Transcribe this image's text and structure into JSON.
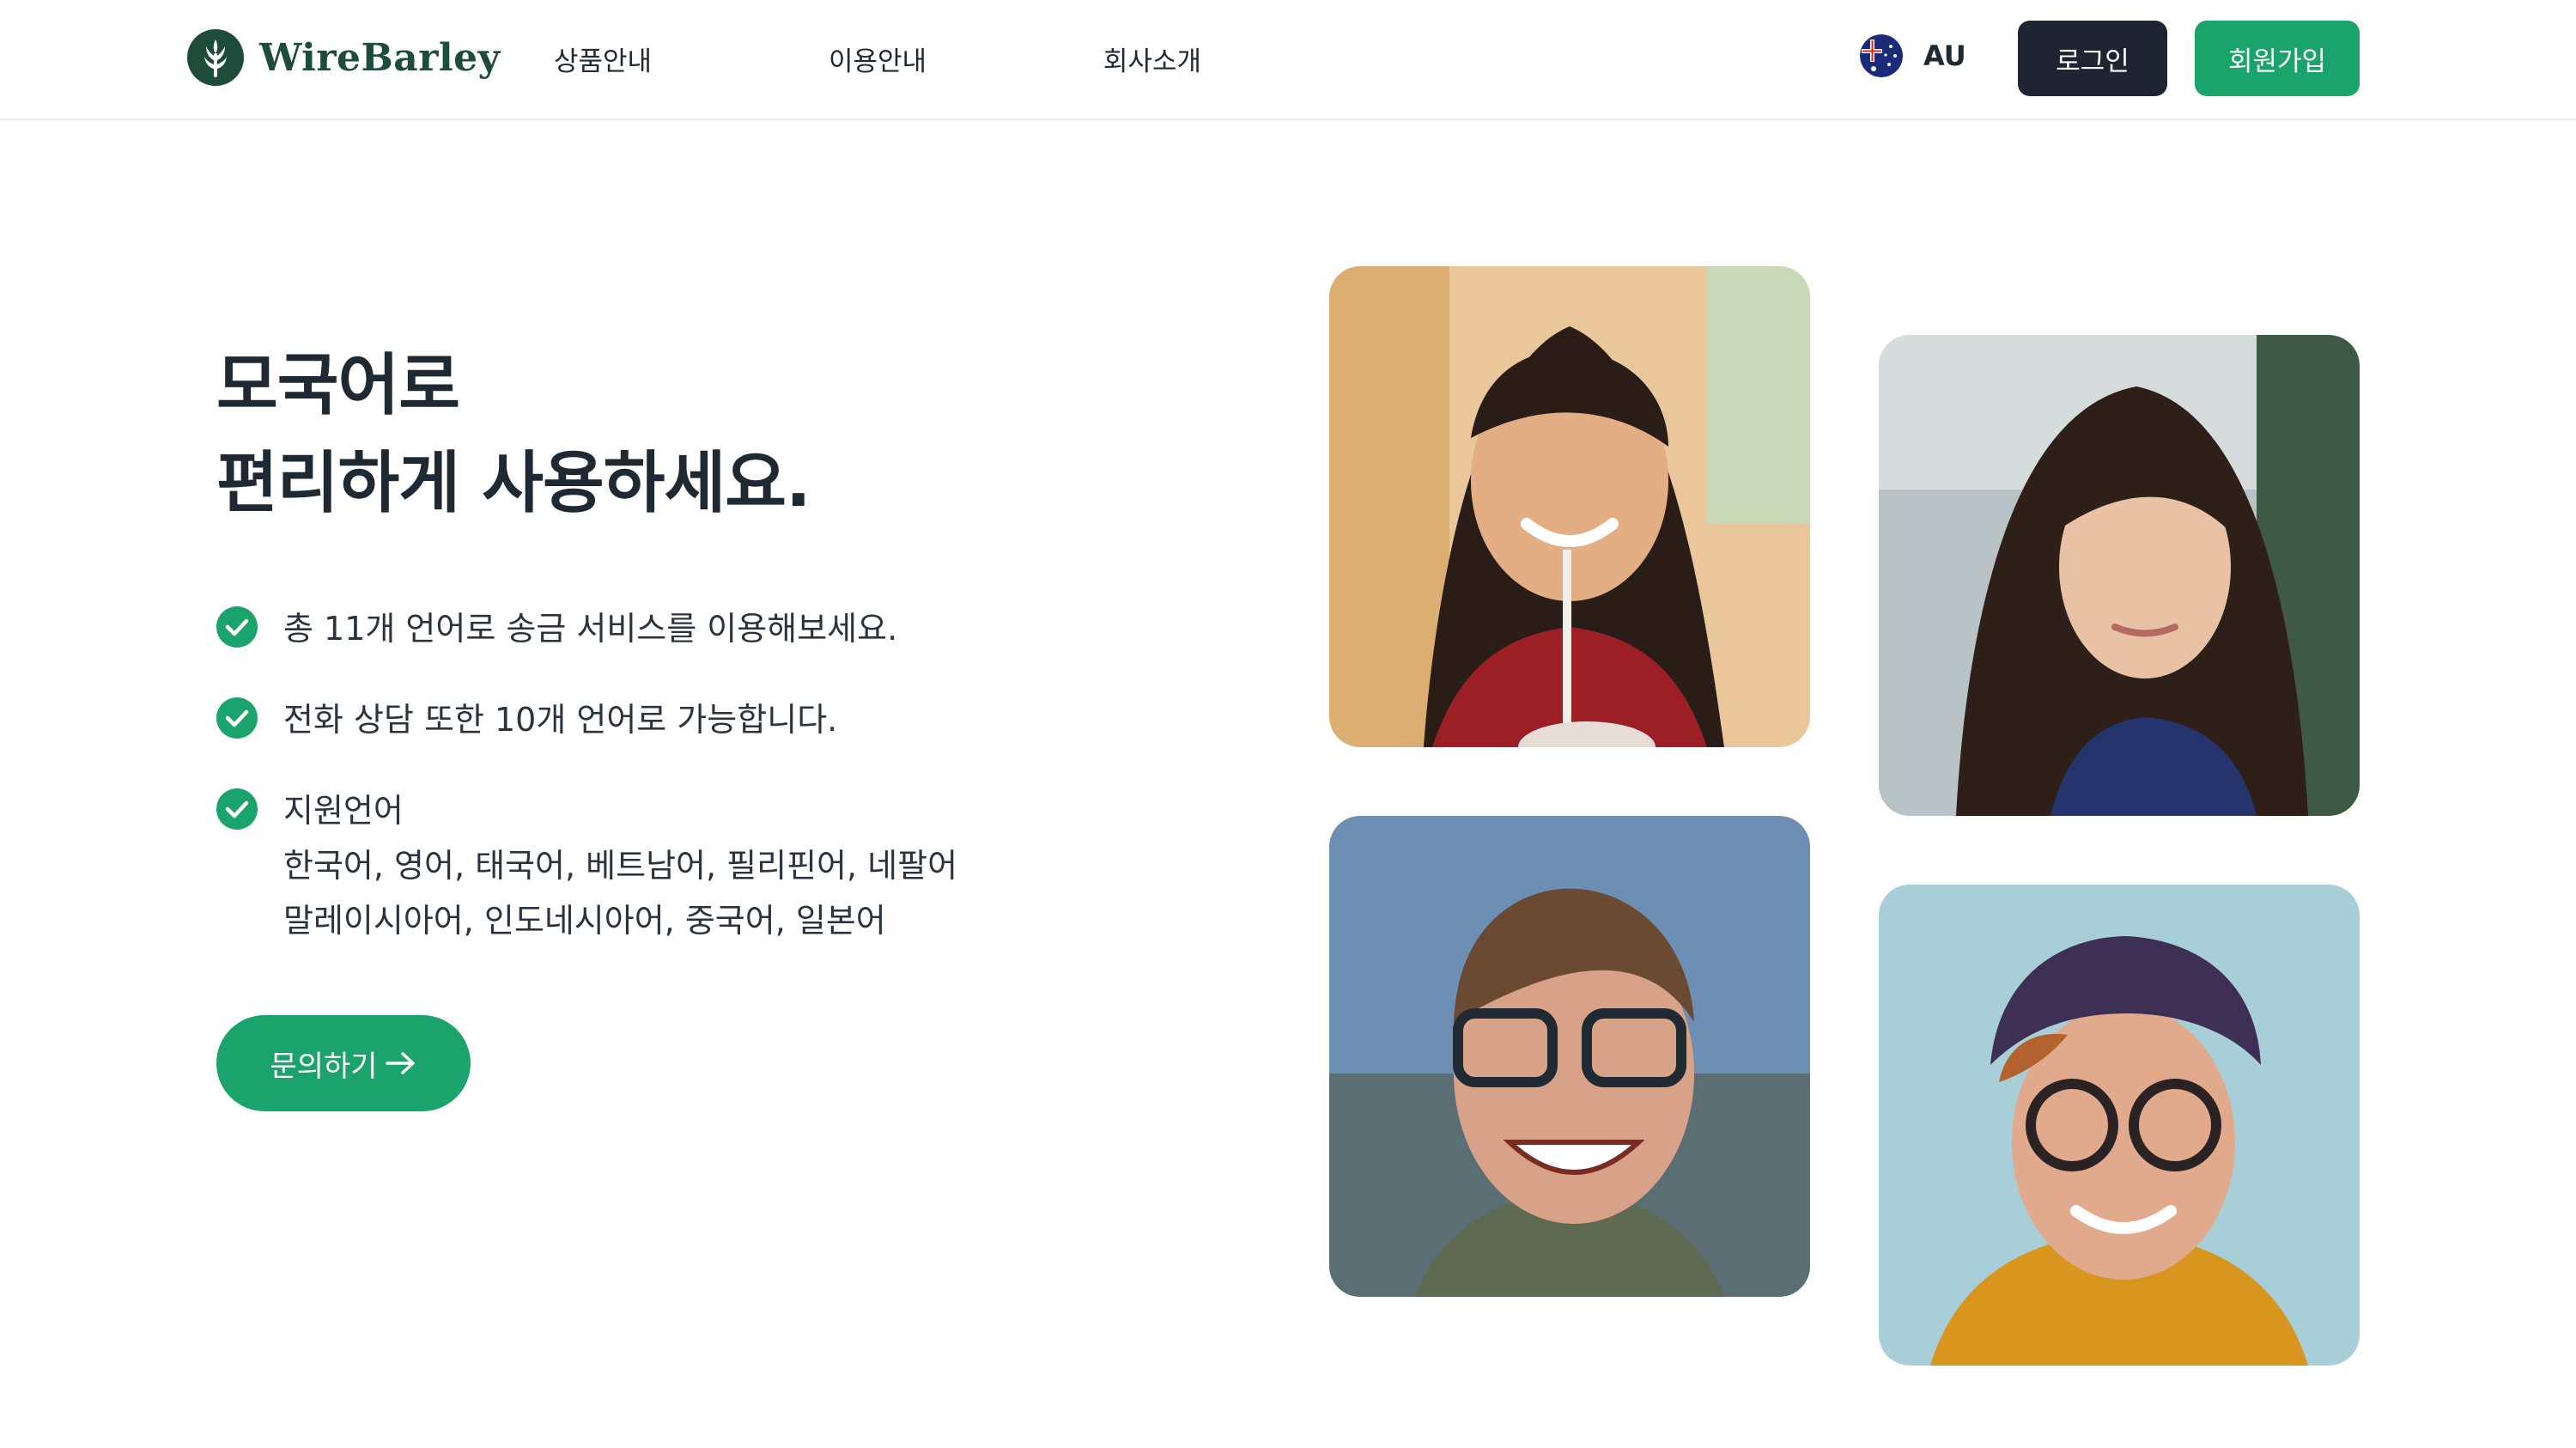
{
  "header": {
    "brand": "WireBarley",
    "nav": [
      "상품안내",
      "이용안내",
      "회사소개"
    ],
    "locale": "AU",
    "login_label": "로그인",
    "signup_label": "회원가입"
  },
  "hero": {
    "title_line1": "모국어로",
    "title_line2": "편리하게 사용하세요.",
    "features": [
      {
        "lines": [
          "총 11개 언어로 송금 서비스를 이용해보세요."
        ]
      },
      {
        "lines": [
          "전화 상담 또한 10개 언어로 가능합니다."
        ]
      },
      {
        "lines": [
          "지원언어",
          "한국어, 영어, 태국어, 베트남어, 필리핀어, 네팔어",
          "말레이시아어, 인도네시아어, 중국어, 일본어"
        ]
      }
    ],
    "cta_label": "문의하기"
  },
  "colors": {
    "brand_green": "#1aa36a",
    "dark_button": "#1e2431",
    "logo_green": "#1d4d3a"
  },
  "icons": [
    "wirebarley-logo-icon",
    "australia-flag-icon",
    "check-circle-icon",
    "arrow-right-icon"
  ]
}
